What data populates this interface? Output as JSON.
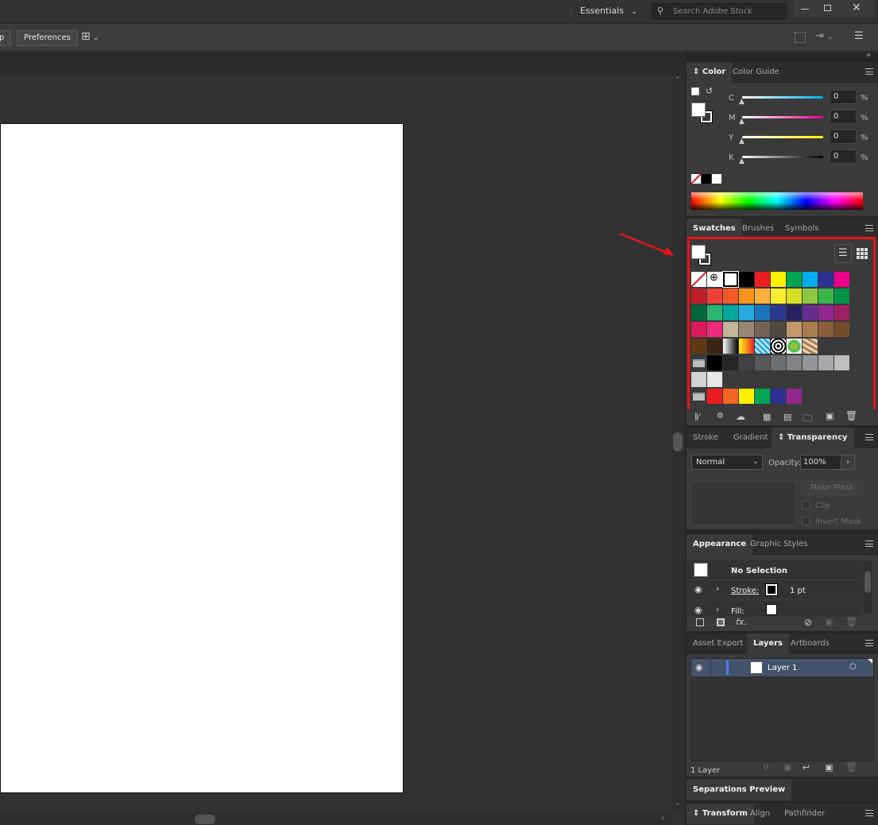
{
  "titlebar": {
    "workspace_label": "Essentials",
    "search_placeholder": "Search Adobe Stock"
  },
  "controlbar": {
    "partial_button_label": "p",
    "preferences_label": "Preferences"
  },
  "color_panel": {
    "tabs": [
      "Color",
      "Color Guide"
    ],
    "channels": [
      {
        "label": "C",
        "value": "0",
        "unit": "%"
      },
      {
        "label": "M",
        "value": "0",
        "unit": "%"
      },
      {
        "label": "Y",
        "value": "0",
        "unit": "%"
      },
      {
        "label": "K",
        "value": "0",
        "unit": "%"
      }
    ]
  },
  "swatches_panel": {
    "tabs": [
      "Swatches",
      "Brushes",
      "Symbols"
    ],
    "rows": [
      [
        "#ffffff",
        "#ffffff",
        "#ffffff",
        "#000000",
        "#ed1c24",
        "#fff200",
        "#00a651",
        "#00aeef",
        "#2e3192",
        "#ec008c"
      ],
      [
        "#be1e2d",
        "#ef4136",
        "#f15a29",
        "#f7941d",
        "#fbb040",
        "#f9ed32",
        "#d7df23",
        "#8dc63f",
        "#39b54a",
        "#009444"
      ],
      [
        "#006838",
        "#2bb673",
        "#00a79d",
        "#27aae1",
        "#1c75bc",
        "#2b3990",
        "#262262",
        "#662d91",
        "#92278f",
        "#9e1f63"
      ],
      [
        "#da1c5c",
        "#ee2a7b",
        "#c2b59b",
        "#998675",
        "#736357",
        "#534741",
        "#c49a6c",
        "#a97c50",
        "#8b5e3c",
        "#754c29"
      ],
      [
        "#603913",
        "#3c2415",
        "#gradient1",
        "#gradient2",
        "#pattern1",
        "#pattern2",
        "#pattern3",
        "#pattern4"
      ],
      [
        "#folder",
        "#000000",
        "#262626",
        "#414042",
        "#58595b",
        "#6d6e71",
        "#808285",
        "#939598",
        "#a7a9ac",
        "#bcbec0"
      ],
      [
        "#d1d3d4",
        "#e6e7e8"
      ],
      [
        "#folder",
        "#ed1c24",
        "#f26522",
        "#fff200",
        "#00a651",
        "#2e3192",
        "#92278f"
      ]
    ]
  },
  "transparency_panel": {
    "tabs": [
      "Stroke",
      "Gradient",
      "Transparency"
    ],
    "blend_mode": "Normal",
    "opacity_label": "Opacity:",
    "opacity_value": "100%",
    "make_mask_label": "Make Mask",
    "clip_label": "Clip",
    "invert_mask_label": "Invert Mask"
  },
  "appearance_panel": {
    "tabs": [
      "Appearance",
      "Graphic Styles"
    ],
    "selection_label": "No Selection",
    "stroke_label": "Stroke:",
    "stroke_weight": "1 pt",
    "fill_label": "Fill:"
  },
  "layers_panel": {
    "tabs": [
      "Asset Export",
      "Layers",
      "Artboards"
    ],
    "layer_name": "Layer 1",
    "count_label": "1 Layer"
  },
  "separations_panel": {
    "tabs": [
      "Separations Preview"
    ]
  },
  "transform_panel": {
    "tabs": [
      "Transform",
      "Align",
      "Pathfinder"
    ]
  },
  "colors": {
    "highlight_red": "#e4141b",
    "layer_blue": "#4a7ef0"
  }
}
